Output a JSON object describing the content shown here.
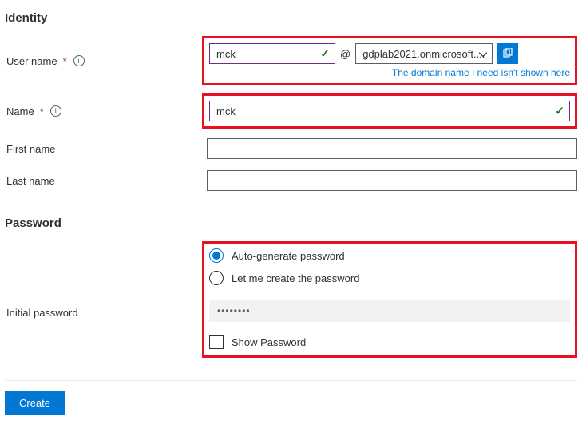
{
  "identity": {
    "heading": "Identity",
    "username_label": "User name",
    "username_value": "mck",
    "at": "@",
    "domain_value": "gdplab2021.onmicrosoft....",
    "domain_hint": "The domain name I need isn't shown here",
    "name_label": "Name",
    "name_value": "mck",
    "first_label": "First name",
    "first_value": "",
    "last_label": "Last name",
    "last_value": ""
  },
  "password": {
    "heading": "Password",
    "opt_auto": "Auto-generate password",
    "opt_manual": "Let me create the password",
    "initial_label": "Initial password",
    "masked": "••••••••",
    "show_label": "Show Password"
  },
  "buttons": {
    "create": "Create"
  },
  "glyph": {
    "info": "i"
  }
}
